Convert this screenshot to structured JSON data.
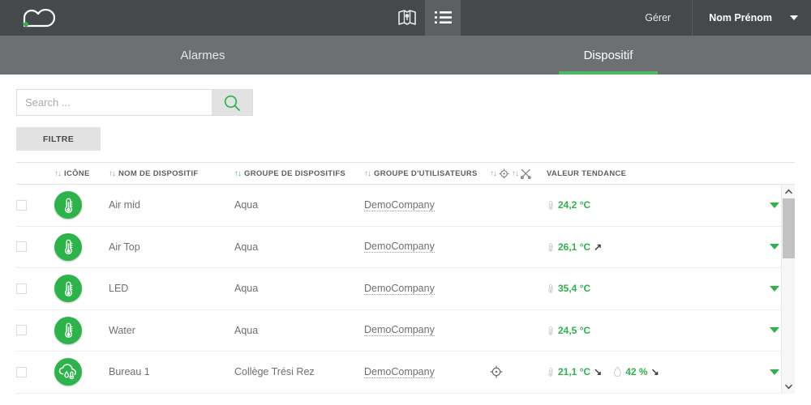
{
  "header": {
    "logo_icon": "cloud-logo-icon",
    "nav": [
      {
        "id": "map",
        "icon": "map-icon",
        "active": false
      },
      {
        "id": "list",
        "icon": "list-icon",
        "active": true
      }
    ],
    "manage_label": "Gérer",
    "user_name": "Nom Prénom",
    "user_caret_icon": "chevron-down-icon",
    "bg_color": "#45494c"
  },
  "tabs": {
    "items": [
      {
        "label": "Alarmes",
        "active": false
      },
      {
        "label": "Dispositif",
        "active": true
      }
    ],
    "accent_color": "#4cb963",
    "bg_color": "#6c7073"
  },
  "toolbar": {
    "search_placeholder": "Search ...",
    "search_value": "",
    "search_icon": "search-icon",
    "filter_label": "FILTRE"
  },
  "table": {
    "columns": [
      {
        "key": "check",
        "label": "",
        "sort": "none"
      },
      {
        "key": "icon",
        "label": "ICÔNE",
        "sort": "inactive"
      },
      {
        "key": "name",
        "label": "NOM DE DISPOSITIF",
        "sort": "inactive"
      },
      {
        "key": "dgroup",
        "label": "GROUPE DE DISPOSITIFS",
        "sort": "active"
      },
      {
        "key": "ugroup",
        "label": "GROUPE D'UTILISATEURS",
        "sort": "inactive"
      },
      {
        "key": "extra",
        "label": "",
        "sort": "inactive"
      },
      {
        "key": "value",
        "label": "VALEUR TENDANCE",
        "sort": "none"
      }
    ],
    "sort_glyph": "↑↓",
    "extra_icons": [
      "target-icon",
      "tools-icon"
    ],
    "rows": [
      {
        "checked": false,
        "icon": "thermometer-icon",
        "name": "Air mid",
        "device_group": "Aqua",
        "user_group": "DemoCompany",
        "location_icon": "",
        "values": [
          {
            "type": "temperature",
            "text": "24,2 °C",
            "trend": ""
          }
        ],
        "caret_icon": "chevron-down-icon"
      },
      {
        "checked": false,
        "icon": "thermometer-icon",
        "name": "Air Top",
        "device_group": "Aqua",
        "user_group": "DemoCompany",
        "location_icon": "",
        "values": [
          {
            "type": "temperature",
            "text": "26,1 °C",
            "trend": "↗"
          }
        ],
        "caret_icon": "chevron-down-icon"
      },
      {
        "checked": false,
        "icon": "thermometer-icon",
        "name": "LED",
        "device_group": "Aqua",
        "user_group": "DemoCompany",
        "location_icon": "",
        "values": [
          {
            "type": "temperature",
            "text": "35,4 °C",
            "trend": ""
          }
        ],
        "caret_icon": "chevron-down-icon"
      },
      {
        "checked": false,
        "icon": "thermometer-icon",
        "name": "Water",
        "device_group": "Aqua",
        "user_group": "DemoCompany",
        "location_icon": "",
        "values": [
          {
            "type": "temperature",
            "text": "24,5 °C",
            "trend": ""
          }
        ],
        "caret_icon": "chevron-down-icon"
      },
      {
        "checked": false,
        "icon": "cloud-humidity-icon",
        "name": "Bureau 1",
        "device_group": "Collège Trési Rez",
        "user_group": "DemoCompany",
        "location_icon": "target-icon",
        "values": [
          {
            "type": "temperature",
            "text": "21,1 °C",
            "trend": "↘"
          },
          {
            "type": "humidity",
            "text": "42 %",
            "trend": "↘"
          }
        ],
        "caret_icon": "chevron-down-icon"
      }
    ],
    "value_color": "#2cb34a",
    "icon_bg_color": "#2cb34a"
  },
  "scrollbar": {
    "up_icon": "chevron-up-icon",
    "down_icon": "chevron-down-icon",
    "thumb_position_pct": 0,
    "thumb_size_pct": 33
  }
}
